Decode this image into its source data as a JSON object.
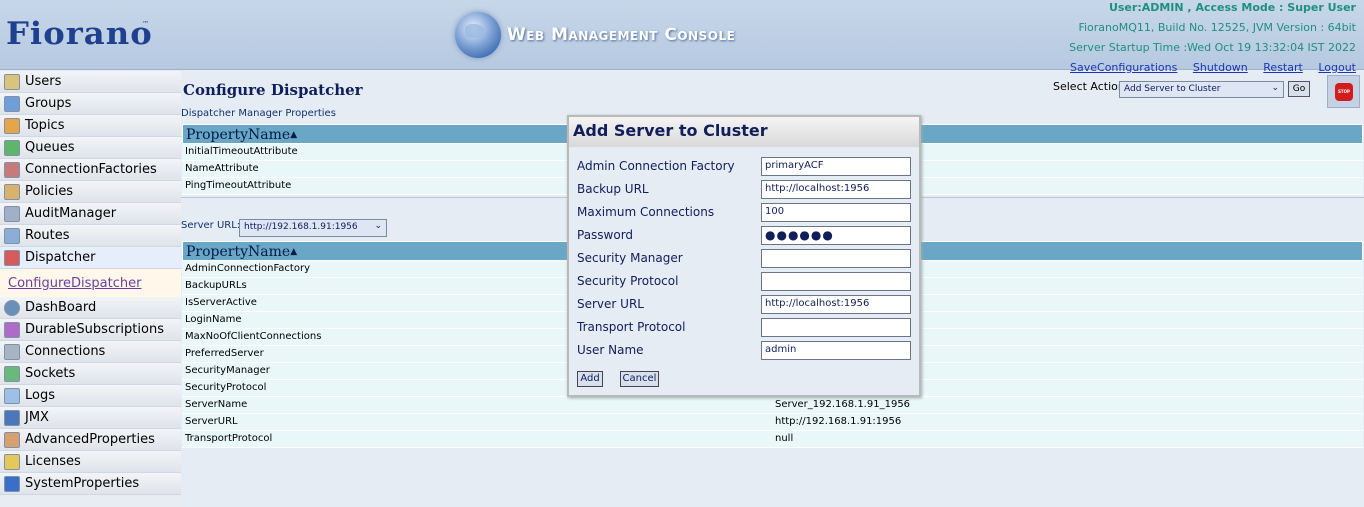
{
  "header": {
    "logo": "Fiorano",
    "console_title": "Web Management Console",
    "user_info": "User:ADMIN , Access Mode : Super User",
    "build_info": "FioranoMQ11, Build No. 12525, JVM Version : 64bit",
    "startup_time": "Server Startup Time :Wed Oct 19 13:32:04 IST 2022",
    "links": [
      "SaveConfigurations",
      "Shutdown",
      "Restart",
      "Logout"
    ]
  },
  "sidebar": {
    "items": [
      {
        "label": "Users",
        "icon": "users-icon"
      },
      {
        "label": "Groups",
        "icon": "groups-icon"
      },
      {
        "label": "Topics",
        "icon": "topics-icon"
      },
      {
        "label": "Queues",
        "icon": "queues-icon"
      },
      {
        "label": "ConnectionFactories",
        "icon": "connection-factories-icon"
      },
      {
        "label": "Policies",
        "icon": "policies-icon"
      },
      {
        "label": "AuditManager",
        "icon": "audit-manager-icon"
      },
      {
        "label": "Routes",
        "icon": "routes-icon"
      },
      {
        "label": "Dispatcher",
        "icon": "dispatcher-icon"
      }
    ],
    "sub_item": "ConfigureDispatcher",
    "items2": [
      {
        "label": "DashBoard",
        "icon": "dashboard-icon"
      },
      {
        "label": "DurableSubscriptions",
        "icon": "durable-subscriptions-icon"
      },
      {
        "label": "Connections",
        "icon": "connections-icon"
      },
      {
        "label": "Sockets",
        "icon": "sockets-icon"
      },
      {
        "label": "Logs",
        "icon": "logs-icon"
      },
      {
        "label": "JMX",
        "icon": "jmx-icon"
      },
      {
        "label": "AdvancedProperties",
        "icon": "advanced-properties-icon"
      },
      {
        "label": "Licenses",
        "icon": "licenses-icon"
      },
      {
        "label": "SystemProperties",
        "icon": "system-properties-icon"
      }
    ]
  },
  "main": {
    "title": "Configure Dispatcher",
    "select_action_label": "Select Action :",
    "select_action_value": "Add Server to Cluster",
    "go_label": "Go",
    "section1_label": "Dispatcher Manager Properties",
    "table_header": "PropertyName",
    "table1_rows": [
      "InitialTimeoutAttribute",
      "NameAttribute",
      "PingTimeoutAttribute"
    ],
    "server_url_label": "Server URL::",
    "server_url_value": "http://192.168.1.91:1956",
    "table2_rows": [
      {
        "name": "AdminConnectionFactory",
        "value": ""
      },
      {
        "name": "BackupURLs",
        "value": ""
      },
      {
        "name": "IsServerActive",
        "value": ""
      },
      {
        "name": "LoginName",
        "value": ""
      },
      {
        "name": "MaxNoOfClientConnections",
        "value": ""
      },
      {
        "name": "PreferredServer",
        "value": ""
      },
      {
        "name": "SecurityManager",
        "value": ""
      },
      {
        "name": "SecurityProtocol",
        "value": ""
      },
      {
        "name": "ServerName",
        "value": "Server_192.168.1.91_1956"
      },
      {
        "name": "ServerURL",
        "value": "http://192.168.1.91:1956"
      },
      {
        "name": "TransportProtocol",
        "value": "null"
      }
    ]
  },
  "dialog": {
    "title": "Add Server to Cluster",
    "fields": [
      {
        "label": "Admin Connection Factory",
        "value": "primaryACF"
      },
      {
        "label": "Backup URL",
        "value": "http://localhost:1956"
      },
      {
        "label": "Maximum Connections",
        "value": "100"
      },
      {
        "label": "Password",
        "value": "●●●●●●"
      },
      {
        "label": "Security Manager",
        "value": ""
      },
      {
        "label": "Security Protocol",
        "value": ""
      },
      {
        "label": "Server URL",
        "value": "http://localhost:1956"
      },
      {
        "label": "Transport Protocol",
        "value": ""
      },
      {
        "label": "User Name",
        "value": "admin"
      }
    ],
    "add_label": "Add",
    "cancel_label": "Cancel"
  }
}
